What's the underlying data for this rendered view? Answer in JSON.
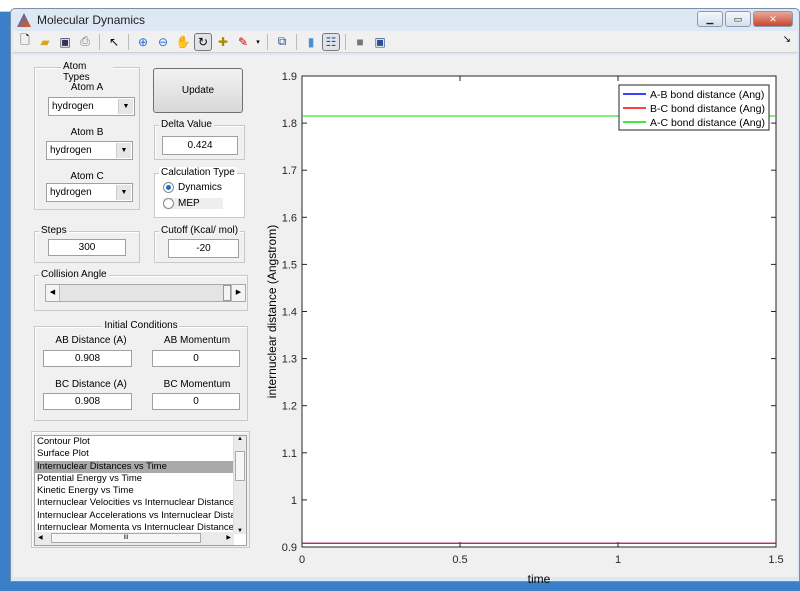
{
  "window": {
    "title": "Molecular Dynamics"
  },
  "toolbar": {
    "icons": [
      "new-file-icon",
      "open-folder-icon",
      "save-icon",
      "print-icon",
      "pointer-icon",
      "zoom-in-icon",
      "zoom-out-icon",
      "pan-hand-icon",
      "rotate-3d-icon",
      "data-cursor-icon",
      "brush-icon",
      "link-plot-icon",
      "colorbar-icon",
      "legend-icon",
      "hide-plot-tools-icon",
      "show-plot-tools-icon"
    ],
    "dock_arrow": "↘"
  },
  "controls": {
    "atom_types": {
      "title": "Atom Types",
      "atom_a_label": "Atom A",
      "atom_a": "hydrogen",
      "atom_b_label": "Atom B",
      "atom_b": "hydrogen",
      "atom_c_label": "Atom C",
      "atom_c": "hydrogen"
    },
    "update_label": "Update",
    "delta": {
      "title": "Delta Value",
      "value": "0.424"
    },
    "calc_type": {
      "title": "Calculation Type",
      "options": [
        "Dynamics",
        "MEP"
      ],
      "selected": "Dynamics"
    },
    "steps": {
      "title": "Steps",
      "value": "300"
    },
    "cutoff": {
      "title": "Cutoff (Kcal/ mol)",
      "value": "-20"
    },
    "collision_angle": {
      "title": "Collision Angle",
      "slider_fraction": 1.0
    },
    "initial": {
      "title": "Initial Conditions",
      "ab_dist_label": "AB Distance (A)",
      "ab_dist": "0.908",
      "ab_mom_label": "AB Momentum",
      "ab_mom": "0",
      "bc_dist_label": "BC Distance (A)",
      "bc_dist": "0.908",
      "bc_mom_label": "BC Momentum",
      "bc_mom": "0"
    },
    "plot_list": {
      "items": [
        "Contour Plot",
        "Surface Plot",
        "Internuclear Distances vs Time",
        "Potential Energy vs Time",
        "Kinetic Energy vs Time",
        "Internuclear Velocities vs Internuclear Distance",
        "Internuclear Accelerations vs Internuclear Distance",
        "Internuclear Momenta vs Internuclear Distance"
      ],
      "selected": "Internuclear Distances vs Time"
    }
  },
  "chart_data": {
    "type": "line",
    "xlabel": "time",
    "ylabel": "internuclear distance (Angstrom)",
    "xlim": [
      0,
      1.5
    ],
    "ylim": [
      0.9,
      1.9
    ],
    "xticks": [
      "0",
      "0.5",
      "1",
      "1.5"
    ],
    "yticks": [
      "0.9",
      "1",
      "1.1",
      "1.2",
      "1.3",
      "1.4",
      "1.5",
      "1.6",
      "1.7",
      "1.8",
      "1.9"
    ],
    "legend_position": "top-right",
    "grid": false,
    "series": [
      {
        "name": "A-B bond distance (Ang)",
        "color": "#0000ff",
        "x": [
          0,
          0.5,
          1,
          1.5
        ],
        "y": [
          0.908,
          0.908,
          0.908,
          0.908
        ]
      },
      {
        "name": "B-C bond distance (Ang)",
        "color": "#ff0000",
        "x": [
          0,
          0.5,
          1,
          1.5
        ],
        "y": [
          0.908,
          0.908,
          0.908,
          0.908
        ]
      },
      {
        "name": "A-C bond distance (Ang)",
        "color": "#00e000",
        "x": [
          0,
          0.5,
          1,
          1.5
        ],
        "y": [
          1.815,
          1.815,
          1.815,
          1.815
        ]
      }
    ]
  }
}
